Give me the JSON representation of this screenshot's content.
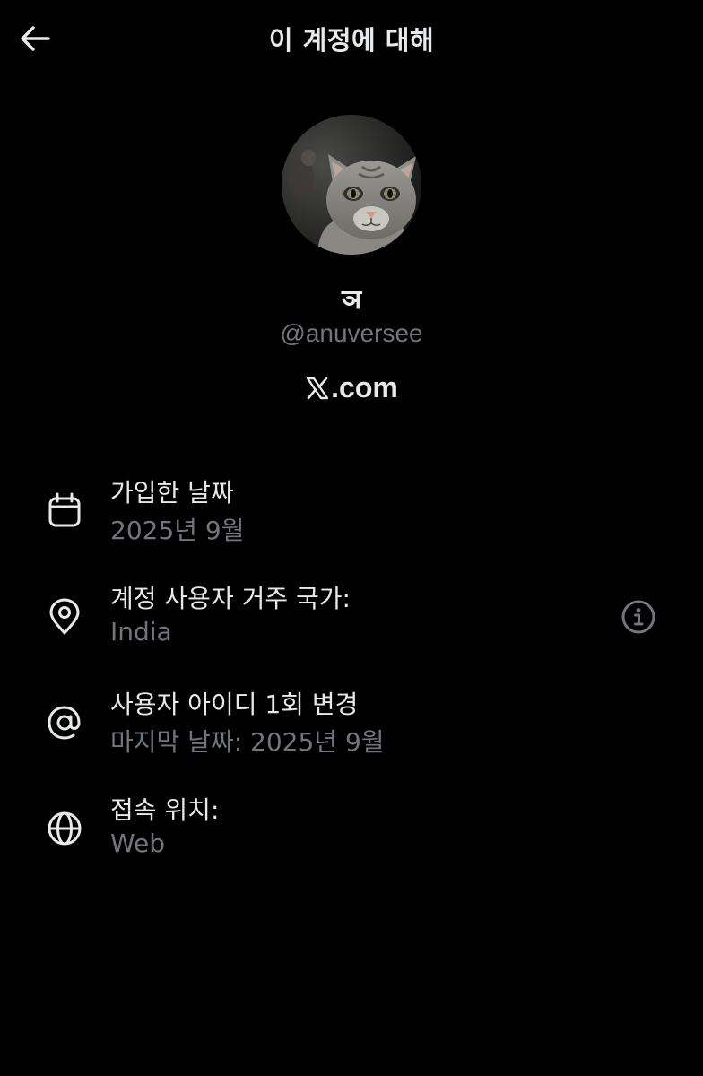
{
  "header": {
    "back_icon": "arrow-left-icon",
    "title": "이 계정에 대해"
  },
  "profile": {
    "display_name": "ञ",
    "handle": "@anuversee",
    "site_logo_icon": "x-logo-icon",
    "site_text": ".com"
  },
  "details": [
    {
      "icon": "calendar-icon",
      "label": "가입한 날짜",
      "value": "2025년 9월"
    },
    {
      "icon": "location-pin-icon",
      "label": "계정 사용자 거주 국가:",
      "value": "India",
      "action_icon": "info-icon"
    },
    {
      "icon": "at-sign-icon",
      "label": "사용자 아이디 1회 변경",
      "value": "마지막 날짜: 2025년 9월"
    },
    {
      "icon": "globe-icon",
      "label": "접속 위치:",
      "value": "Web"
    }
  ],
  "colors": {
    "background": "#000000",
    "primary_text": "#e7e9ea",
    "secondary_text": "#71767b"
  }
}
